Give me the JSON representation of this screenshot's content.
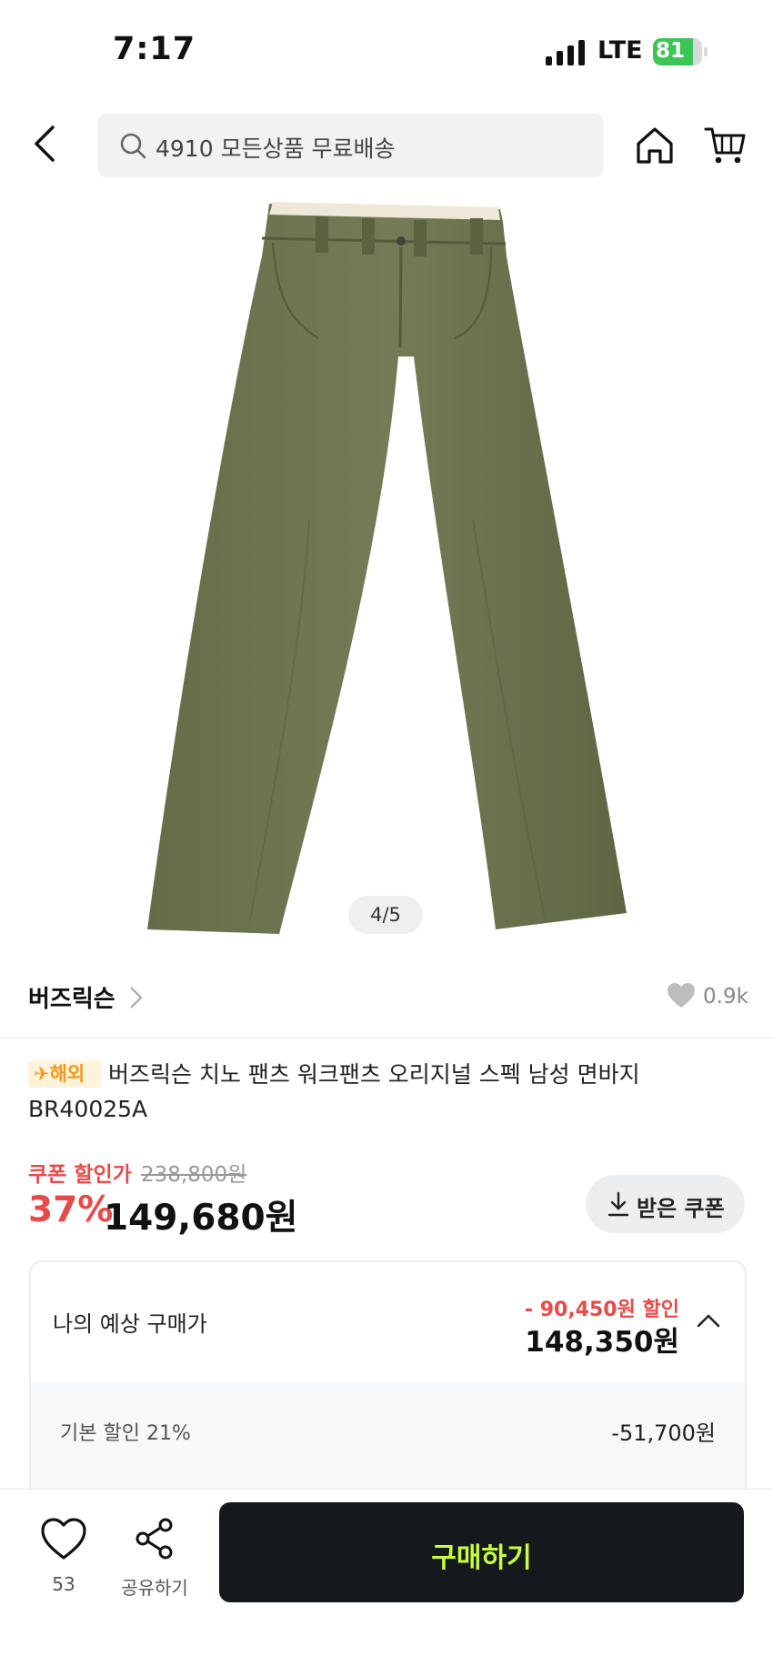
{
  "status_bar": {
    "time": "7:17",
    "network": "LTE",
    "battery": "81",
    "battery_level": 0.81
  },
  "header": {
    "search_placeholder": "4910 모든상품 무료배송"
  },
  "product": {
    "image_page": "4/5",
    "brand": "버즈릭슨",
    "likes": "0.9k",
    "badge": "✈해외",
    "title": "버즈릭슨 치노 팬츠 워크팬츠 오리지널 스펙 남성 면바지 BR40025A"
  },
  "price": {
    "coupon_label": "쿠폰 할인가",
    "original": "238,800원",
    "discount_rate": "37%",
    "current": "149,680원",
    "coupon_button": "받은 쿠폰"
  },
  "expected": {
    "label": "나의 예상 구매가",
    "discount": "- 90,450원 할인",
    "price": "148,350원",
    "items": [
      {
        "label": "기본 할인 21%",
        "value": "-51,700원"
      }
    ]
  },
  "bottom_bar": {
    "wish_count": "53",
    "share_label": "공유하기",
    "buy_label": "구매하기"
  },
  "colors": {
    "accent_red": "#e84a4a",
    "buy_button": "#15181c",
    "buy_text": "#c8ff3c",
    "pants": "#6b7450",
    "battery": "#3ec456"
  }
}
